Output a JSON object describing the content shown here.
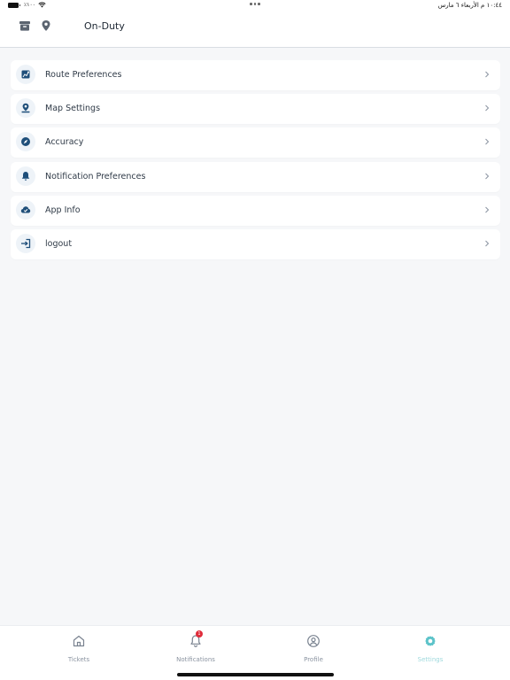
{
  "status_bar": {
    "battery_text": "٪١٠٠",
    "datetime": "١٠:٤٤ م  الأربعاء ٦ مارس"
  },
  "header": {
    "title": "On-Duty",
    "icons": [
      "archive-icon",
      "location-pin-icon"
    ]
  },
  "menu": {
    "items": [
      {
        "label": "Route Preferences",
        "icon": "route-map-icon"
      },
      {
        "label": "Map Settings",
        "icon": "map-pin-icon"
      },
      {
        "label": "Accuracy",
        "icon": "compass-icon"
      },
      {
        "label": "Notification Preferences",
        "icon": "bell-icon"
      },
      {
        "label": "App Info",
        "icon": "cloud-check-icon"
      },
      {
        "label": "logout",
        "icon": "logout-icon"
      }
    ]
  },
  "tab_bar": {
    "tabs": [
      {
        "label": "Tickets",
        "icon": "home-icon"
      },
      {
        "label": "Notifications",
        "icon": "bell-outline-icon",
        "badge": "1"
      },
      {
        "label": "Profile",
        "icon": "user-circle-icon"
      },
      {
        "label": "Settings",
        "icon": "gear-icon",
        "active": true
      }
    ]
  },
  "colors": {
    "accent_blue": "#1f4f7a",
    "active_tab": "#5cc3c9",
    "badge": "#e02c3a",
    "background": "#f6f7f9"
  }
}
